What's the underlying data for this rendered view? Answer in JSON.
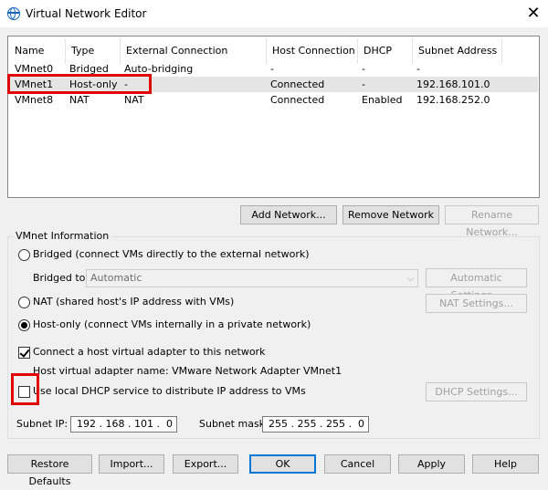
{
  "window": {
    "title": "Virtual Network Editor",
    "close_glyph": "✕"
  },
  "table": {
    "headers": [
      "Name",
      "Type",
      "External Connection",
      "Host Connection",
      "DHCP",
      "Subnet Address"
    ],
    "rows": [
      [
        "VMnet0",
        "Bridged",
        "Auto-bridging",
        "-",
        "-",
        "-"
      ],
      [
        "VMnet1",
        "Host-only",
        "-",
        "Connected",
        "-",
        "192.168.101.0"
      ],
      [
        "VMnet8",
        "NAT",
        "NAT",
        "Connected",
        "Enabled",
        "192.168.252.0"
      ]
    ],
    "selected_row": 1
  },
  "buttons": {
    "add_network": "Add Network...",
    "remove_network": "Remove Network",
    "rename_network": "Rename Network..."
  },
  "vmnet_info": {
    "group_label": "VMnet Information",
    "bridged_label": "Bridged (connect VMs directly to the external network)",
    "bridged_to_label": "Bridged to:",
    "bridged_to_value": "Automatic",
    "automatic_settings": "Automatic Settings...",
    "nat_label": "NAT (shared host's IP address with VMs)",
    "nat_settings": "NAT Settings...",
    "hostonly_label": "Host-only (connect VMs internally in a private network)",
    "connect_adapter_label": "Connect a host virtual adapter to this network",
    "adapter_name_label": "Host virtual adapter name: VMware Network Adapter VMnet1",
    "dhcp_label": "Use local DHCP service to distribute IP address to VMs",
    "dhcp_settings": "DHCP Settings...",
    "selected_mode": "host-only",
    "connect_adapter_checked": true,
    "dhcp_checked": false
  },
  "subnet": {
    "ip_label": "Subnet IP:",
    "ip_value": "192 . 168 . 101 .  0",
    "mask_label": "Subnet mask:",
    "mask_value": "255 . 255 . 255 .  0"
  },
  "footer": {
    "restore_defaults": "Restore Defaults",
    "import": "Import...",
    "export": "Export...",
    "ok": "OK",
    "cancel": "Cancel",
    "apply": "Apply",
    "help": "Help"
  },
  "colors": {
    "highlight": "#e00000",
    "selection": "#e5e5e5",
    "focus": "#0078d7"
  }
}
